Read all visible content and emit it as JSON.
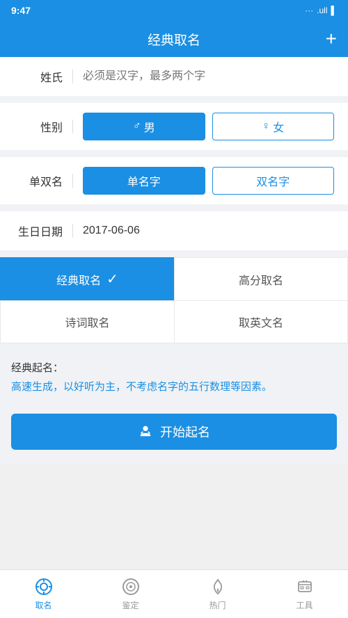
{
  "statusBar": {
    "time": "9:47",
    "icons": "... .ull"
  },
  "header": {
    "title": "经典取名",
    "addLabel": "+"
  },
  "form": {
    "surname": {
      "label": "姓氏",
      "placeholder": "必须是汉字，最多两个字"
    },
    "gender": {
      "label": "性别",
      "options": [
        {
          "value": "male",
          "text": "♂ 男",
          "active": true
        },
        {
          "value": "female",
          "text": "♀ 女",
          "active": false
        }
      ]
    },
    "nameType": {
      "label": "单双名",
      "options": [
        {
          "value": "single",
          "text": "单名字",
          "active": true
        },
        {
          "value": "double",
          "text": "双名字",
          "active": false
        }
      ]
    },
    "birthday": {
      "label": "生日日期",
      "value": "2017-06-06"
    }
  },
  "tabs": [
    {
      "id": "classic",
      "label": "经典取名",
      "active": true,
      "showCheck": true
    },
    {
      "id": "highscore",
      "label": "高分取名",
      "active": false,
      "showCheck": false
    },
    {
      "id": "poem",
      "label": "诗词取名",
      "active": false,
      "showCheck": false
    },
    {
      "id": "english",
      "label": "取英文名",
      "active": false,
      "showCheck": false
    }
  ],
  "description": {
    "title": "经典起名：",
    "text": "高速生成，以好听为主，不考虑名字的五行数理等因素。"
  },
  "startButton": {
    "label": "开始起名"
  },
  "bottomNav": [
    {
      "id": "naming",
      "label": "取名",
      "active": true
    },
    {
      "id": "appraisal",
      "label": "鉴定",
      "active": false
    },
    {
      "id": "hot",
      "label": "热门",
      "active": false
    },
    {
      "id": "tools",
      "label": "工具",
      "active": false
    }
  ]
}
